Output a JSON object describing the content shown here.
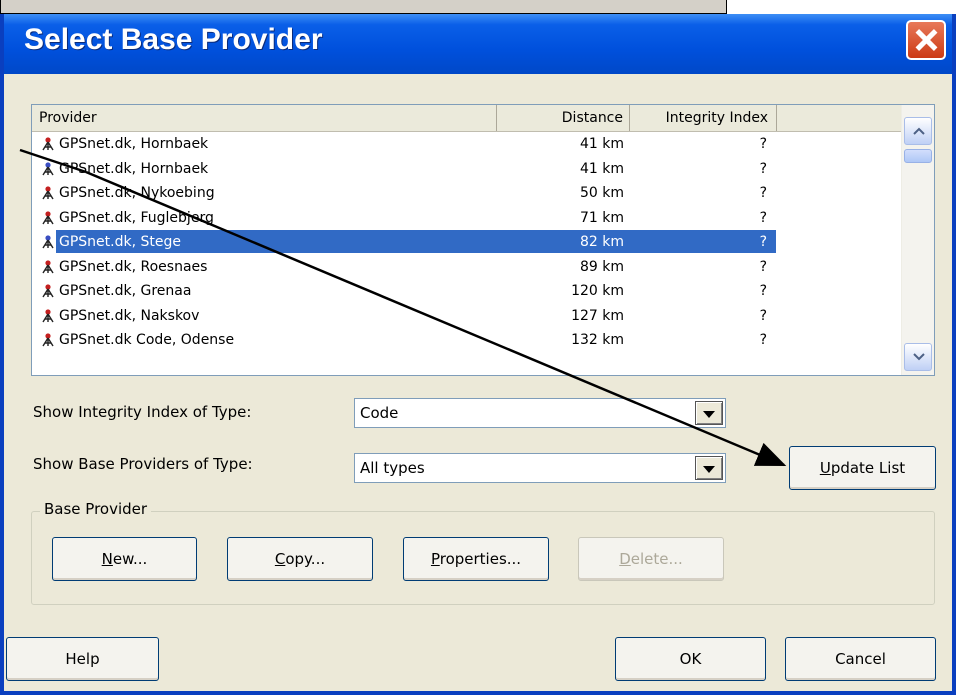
{
  "dialog": {
    "title": "Select Base Provider"
  },
  "columns": [
    "Provider",
    "Distance",
    "Integrity Index"
  ],
  "rows": [
    {
      "provider": "GPSnet.dk, Hornbaek",
      "distance": "41 km",
      "integrity": "?"
    },
    {
      "provider": "GPSnet.dk, Hornbaek",
      "distance": "41 km",
      "integrity": "?"
    },
    {
      "provider": "GPSnet.dk, Nykoebing",
      "distance": "50 km",
      "integrity": "?"
    },
    {
      "provider": "GPSnet.dk, Fuglebjerg",
      "distance": "71 km",
      "integrity": "?"
    },
    {
      "provider": "GPSnet.dk, Stege",
      "distance": "82 km",
      "integrity": "?",
      "selected": true
    },
    {
      "provider": "GPSnet.dk, Roesnaes",
      "distance": "89 km",
      "integrity": "?"
    },
    {
      "provider": "GPSnet.dk, Grenaa",
      "distance": "120 km",
      "integrity": "?"
    },
    {
      "provider": "GPSnet.dk, Nakskov",
      "distance": "127 km",
      "integrity": "?"
    },
    {
      "provider": "GPSnet.dk Code, Odense",
      "distance": "132 km",
      "integrity": "?"
    }
  ],
  "integrity_type": {
    "label": "Show Integrity Index of Type:",
    "value": "Code"
  },
  "provider_type": {
    "label": "Show Base Providers of Type:",
    "value": "All types"
  },
  "buttons": {
    "update_first": "U",
    "update_rest": "pdate List",
    "new_first": "N",
    "new_rest": "ew...",
    "copy_first": "C",
    "copy_rest": "opy...",
    "props_first": "P",
    "props_rest": "roperties...",
    "delete_first": "D",
    "delete_rest": "elete...",
    "help": "Help",
    "ok": "OK",
    "cancel": "Cancel"
  },
  "group": {
    "label": "Base Provider"
  },
  "colors": {
    "titlebar": "#0050dc",
    "selection": "#316ac5",
    "face": "#ece9d8",
    "close": "#cc3a14"
  },
  "icons": {
    "provider": "survey-tripod-icon",
    "close": "close-icon"
  }
}
